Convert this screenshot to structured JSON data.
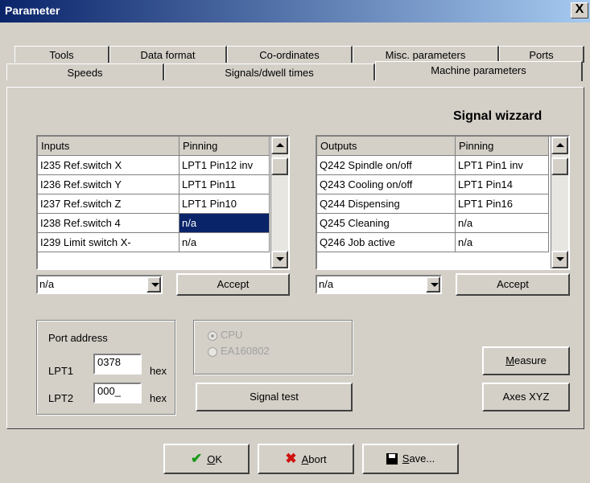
{
  "window": {
    "title": "Parameter",
    "close_label": "X"
  },
  "tabs_row1": [
    "Tools",
    "Data format",
    "Co-ordinates",
    "Misc. parameters",
    "Ports"
  ],
  "tabs_row2": [
    "Speeds",
    "Signals/dwell times",
    "Machine parameters"
  ],
  "active_tab": "Machine parameters",
  "section_title": "Signal wizzard",
  "inputs_table": {
    "headers": [
      "Inputs",
      "Pinning"
    ],
    "rows": [
      [
        "I235 Ref.switch X",
        "LPT1 Pin12 inv"
      ],
      [
        "I236 Ref.switch Y",
        "LPT1 Pin11"
      ],
      [
        "I237 Ref.switch Z",
        "LPT1 Pin10"
      ],
      [
        "I238 Ref.switch 4",
        "n/a"
      ],
      [
        "I239 Limit switch X-",
        "n/a"
      ]
    ],
    "selected_row": 3,
    "combo_value": "n/a",
    "accept_label": "Accept"
  },
  "outputs_table": {
    "headers": [
      "Outputs",
      "Pinning"
    ],
    "rows": [
      [
        "Q242 Spindle on/off",
        "LPT1 Pin1 inv"
      ],
      [
        "Q243 Cooling on/off",
        "LPT1 Pin14"
      ],
      [
        "Q244 Dispensing",
        "LPT1 Pin16"
      ],
      [
        "Q245 Cleaning",
        "n/a"
      ],
      [
        "Q246 Job active",
        "n/a"
      ]
    ],
    "combo_value": "n/a",
    "accept_label": "Accept"
  },
  "port_address": {
    "label": "Port address",
    "lpt1_label": "LPT1",
    "lpt1_value": "0378",
    "lpt2_label": "LPT2",
    "lpt2_value": "000_",
    "unit": "hex"
  },
  "interface": {
    "options": [
      "CPU",
      "EA160802"
    ],
    "selected": "CPU",
    "signal_test_label": "Signal test"
  },
  "buttons": {
    "measure_first": "M",
    "measure_rest": "easure",
    "axes_label": "Axes XYZ",
    "ok_first": "O",
    "ok_rest": "K",
    "abort_first": "A",
    "abort_rest": "bort",
    "save_first": "S",
    "save_rest": "ave..."
  },
  "colors": {
    "titlebar_start": "#0a246a",
    "titlebar_end": "#a6caf0",
    "selection": "#0a246a",
    "face": "#d4d0c8"
  }
}
